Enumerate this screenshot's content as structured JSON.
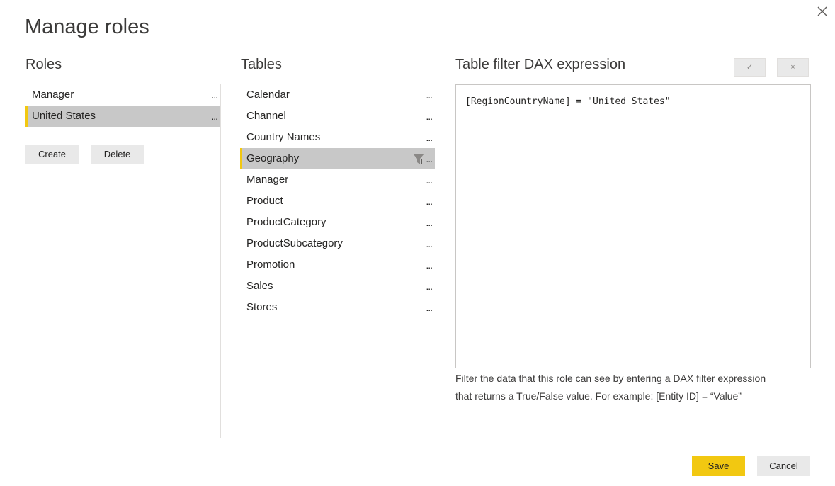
{
  "dialog": {
    "title": "Manage roles",
    "close_icon": "close-icon"
  },
  "roles": {
    "heading": "Roles",
    "items": [
      {
        "label": "Manager",
        "more": "...",
        "selected": false
      },
      {
        "label": "United States",
        "more": "...",
        "selected": true
      }
    ],
    "create_label": "Create",
    "delete_label": "Delete"
  },
  "tables": {
    "heading": "Tables",
    "items": [
      {
        "label": "Calendar",
        "more": "...",
        "selected": false,
        "filtered": false
      },
      {
        "label": "Channel",
        "more": "...",
        "selected": false,
        "filtered": false
      },
      {
        "label": "Country Names",
        "more": "...",
        "selected": false,
        "filtered": false
      },
      {
        "label": "Geography",
        "more": "...",
        "selected": true,
        "filtered": true
      },
      {
        "label": "Manager",
        "more": "...",
        "selected": false,
        "filtered": false
      },
      {
        "label": "Product",
        "more": "...",
        "selected": false,
        "filtered": false
      },
      {
        "label": "ProductCategory",
        "more": "...",
        "selected": false,
        "filtered": false
      },
      {
        "label": "ProductSubcategory",
        "more": "...",
        "selected": false,
        "filtered": false
      },
      {
        "label": "Promotion",
        "more": "...",
        "selected": false,
        "filtered": false
      },
      {
        "label": "Sales",
        "more": "...",
        "selected": false,
        "filtered": false
      },
      {
        "label": "Stores",
        "more": "...",
        "selected": false,
        "filtered": false
      }
    ]
  },
  "dax": {
    "heading": "Table filter DAX expression",
    "confirm_glyph": "✓",
    "discard_glyph": "×",
    "expression": "[RegionCountryName] = \"United States\"",
    "help_line_1": "Filter the data that this role can see by entering a DAX filter expression",
    "help_line_2": "that returns a True/False value. For example: [Entity ID] = “Value”"
  },
  "footer": {
    "save_label": "Save",
    "cancel_label": "Cancel"
  },
  "colors": {
    "accent": "#f2c811",
    "selected_bg": "#c8c8c8",
    "button_bg": "#e9e9e9"
  }
}
